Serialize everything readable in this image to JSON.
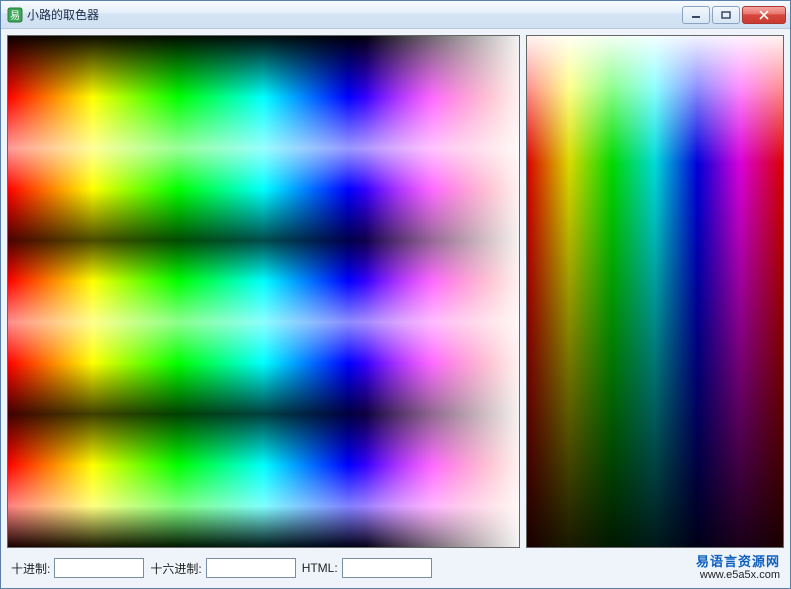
{
  "window": {
    "title": "小路的取色器",
    "icon_name": "e-lang-icon"
  },
  "controls": {
    "minimize": "minimize",
    "maximize": "maximize",
    "close": "close"
  },
  "fields": {
    "decimal": {
      "label": "十进制:",
      "value": ""
    },
    "hex": {
      "label": "十六进制:",
      "value": ""
    },
    "html": {
      "label": "HTML:",
      "value": ""
    }
  },
  "footer": {
    "text_cn": "易语言资源网",
    "url": "www.e5a5x.com"
  },
  "colors": {
    "titlebar_text": "#1a2b48",
    "close_bg": "#d8483e",
    "link": "#1060c0"
  }
}
